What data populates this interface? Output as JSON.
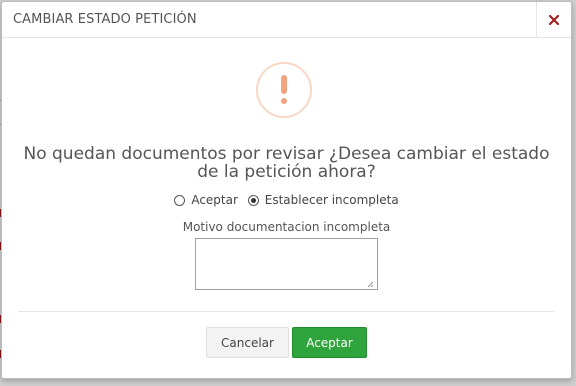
{
  "dialog": {
    "title": "CAMBIAR ESTADO PETICIÓN",
    "close_icon": "close-icon",
    "warning_icon": "exclamation-icon",
    "message": "No quedan documentos por revisar ¿Desea cambiar el estado de la petición ahora?",
    "options": [
      {
        "label": "Aceptar",
        "checked": false
      },
      {
        "label": "Establecer incompleta",
        "checked": true
      }
    ],
    "reason_label": "Motivo documentacion incompleta",
    "reason_value": "",
    "buttons": {
      "cancel": "Cancelar",
      "accept": "Aceptar"
    }
  },
  "colors": {
    "accent_close": "#a02020",
    "warning": "#f2a37d",
    "accept_button": "#2fa43c"
  }
}
